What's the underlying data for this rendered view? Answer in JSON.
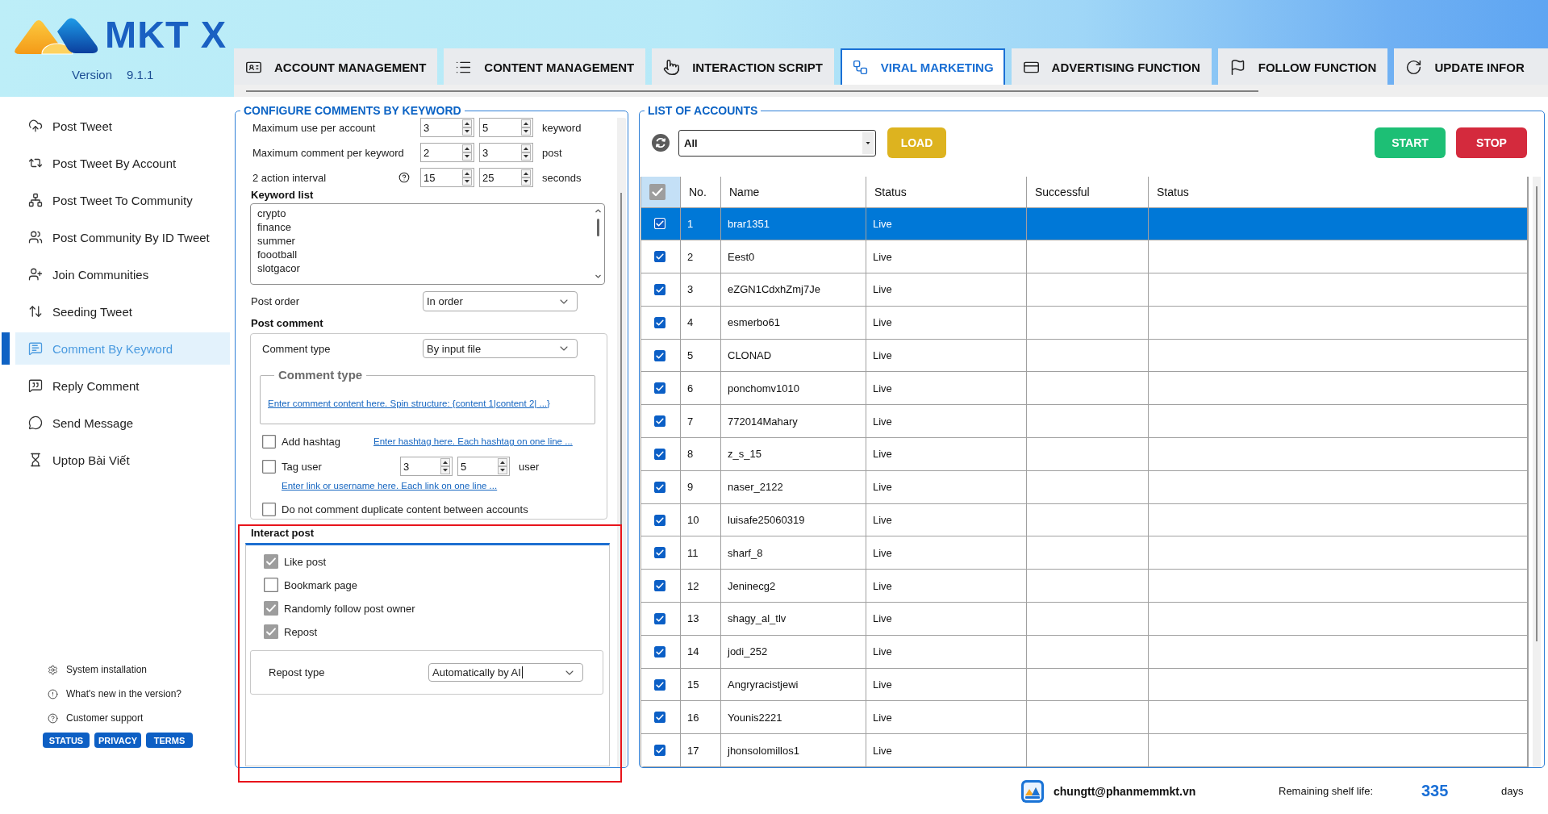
{
  "header": {
    "logo_text": "MKT X",
    "version_label": "Version",
    "version": "9.1.1"
  },
  "tabs": [
    {
      "label": "ACCOUNT MANAGEMENT",
      "selected": false
    },
    {
      "label": "CONTENT MANAGEMENT",
      "selected": false
    },
    {
      "label": "INTERACTION SCRIPT",
      "selected": false
    },
    {
      "label": "VIRAL MARKETING",
      "selected": true
    },
    {
      "label": "ADVERTISING FUNCTION",
      "selected": false
    },
    {
      "label": "FOLLOW FUNCTION",
      "selected": false
    },
    {
      "label": "UPDATE INFOR",
      "selected": false
    }
  ],
  "sidebar": {
    "items": [
      {
        "label": "Post Tweet",
        "selected": false
      },
      {
        "label": "Post Tweet By Account",
        "selected": false
      },
      {
        "label": "Post Tweet To Community",
        "selected": false
      },
      {
        "label": "Post Community By ID Tweet",
        "selected": false
      },
      {
        "label": "Join Communities",
        "selected": false
      },
      {
        "label": "Seeding Tweet",
        "selected": false
      },
      {
        "label": "Comment By Keyword",
        "selected": true
      },
      {
        "label": "Reply Comment",
        "selected": false
      },
      {
        "label": "Send Message",
        "selected": false
      },
      {
        "label": "Uptop Bài Viết",
        "selected": false
      }
    ],
    "links": [
      "System installation",
      "What's new in the version?",
      "Customer support"
    ],
    "buttons": [
      "STATUS",
      "PRIVACY",
      "TERMS"
    ]
  },
  "configure_panel": {
    "title": "CONFIGURE COMMENTS BY KEYWORD",
    "limits": [
      {
        "label": "Maximum use per account",
        "help": false,
        "min": "3",
        "max": "5",
        "unit": "keyword"
      },
      {
        "label": "Maximum comment per keyword",
        "help": false,
        "min": "2",
        "max": "3",
        "unit": "post"
      },
      {
        "label": "2 action interval",
        "help": true,
        "min": "15",
        "max": "25",
        "unit": "seconds"
      }
    ],
    "keyword_list": {
      "label": "Keyword list",
      "keywords": [
        "crypto",
        "finance",
        "summer",
        "foootball",
        "slotgacor"
      ]
    },
    "post_order": {
      "label": "Post order",
      "value": "In order"
    },
    "post_comment": {
      "heading": "Post comment",
      "comment_type": {
        "label": "Comment type",
        "value": "By input file"
      },
      "content_box": {
        "title": "Comment type",
        "link": "Enter comment content here. Spin structure: {content 1|content 2| ...}"
      },
      "options": [
        {
          "kind": "link",
          "label": "Add hashtag",
          "checked": false,
          "link": "Enter hashtag here. Each hashtag on one line ..."
        },
        {
          "kind": "range",
          "label": "Tag user",
          "checked": false,
          "min": "3",
          "max": "5",
          "unit": "user",
          "link": "Enter link or username here. Each link on one line ..."
        },
        {
          "kind": "plain",
          "label": "Do not comment duplicate content between accounts",
          "checked": false
        }
      ]
    },
    "interact_post": {
      "heading": "Interact post",
      "options": [
        {
          "label": "Like post",
          "checked": true
        },
        {
          "label": "Bookmark page",
          "checked": false
        },
        {
          "label": "Randomly follow post owner",
          "checked": true
        },
        {
          "label": "Repost",
          "checked": true
        }
      ],
      "repost_type": {
        "label": "Repost type",
        "value": "Automatically by AI",
        "focused": true
      }
    }
  },
  "accounts_panel": {
    "title": "LIST OF ACCOUNTS",
    "filter": "All",
    "buttons": [
      {
        "kind": "load",
        "label": "LOAD"
      },
      {
        "kind": "start",
        "label": "START"
      },
      {
        "kind": "stop",
        "label": "STOP"
      }
    ],
    "table": {
      "all_checked": true,
      "columns": [
        "No.",
        "Name",
        "Status",
        "Successful",
        "Status"
      ],
      "rows": [
        {
          "no": "1",
          "name": "brar1351",
          "status": "Live",
          "checked": true,
          "selected": true
        },
        {
          "no": "2",
          "name": "Eest0",
          "status": "Live",
          "checked": true,
          "selected": false
        },
        {
          "no": "3",
          "name": "eZGN1CdxhZmj7Je",
          "status": "Live",
          "checked": true,
          "selected": false
        },
        {
          "no": "4",
          "name": "esmerbo61",
          "status": "Live",
          "checked": true,
          "selected": false
        },
        {
          "no": "5",
          "name": "CLONAD",
          "status": "Live",
          "checked": true,
          "selected": false
        },
        {
          "no": "6",
          "name": "ponchomv1010",
          "status": "Live",
          "checked": true,
          "selected": false
        },
        {
          "no": "7",
          "name": "772014Mahary",
          "status": "Live",
          "checked": true,
          "selected": false
        },
        {
          "no": "8",
          "name": "z_s_15",
          "status": "Live",
          "checked": true,
          "selected": false
        },
        {
          "no": "9",
          "name": "naser_2122",
          "status": "Live",
          "checked": true,
          "selected": false
        },
        {
          "no": "10",
          "name": "luisafe25060319",
          "status": "Live",
          "checked": true,
          "selected": false
        },
        {
          "no": "11",
          "name": "sharf_8",
          "status": "Live",
          "checked": true,
          "selected": false
        },
        {
          "no": "12",
          "name": "Jeninecg2",
          "status": "Live",
          "checked": true,
          "selected": false
        },
        {
          "no": "13",
          "name": "shagy_al_tlv",
          "status": "Live",
          "checked": true,
          "selected": false
        },
        {
          "no": "14",
          "name": "jodi_252",
          "status": "Live",
          "checked": true,
          "selected": false
        },
        {
          "no": "15",
          "name": "Angryracistjewi",
          "status": "Live",
          "checked": true,
          "selected": false
        },
        {
          "no": "16",
          "name": "Younis2221",
          "status": "Live",
          "checked": true,
          "selected": false
        },
        {
          "no": "17",
          "name": "jhonsolomillos1",
          "status": "Live",
          "checked": true,
          "selected": false
        }
      ]
    }
  },
  "footer": {
    "email": "chungtt@phanmemmkt.vn",
    "remaining_label": "Remaining shelf life:",
    "remaining_value": "335",
    "remaining_unit": "days"
  }
}
